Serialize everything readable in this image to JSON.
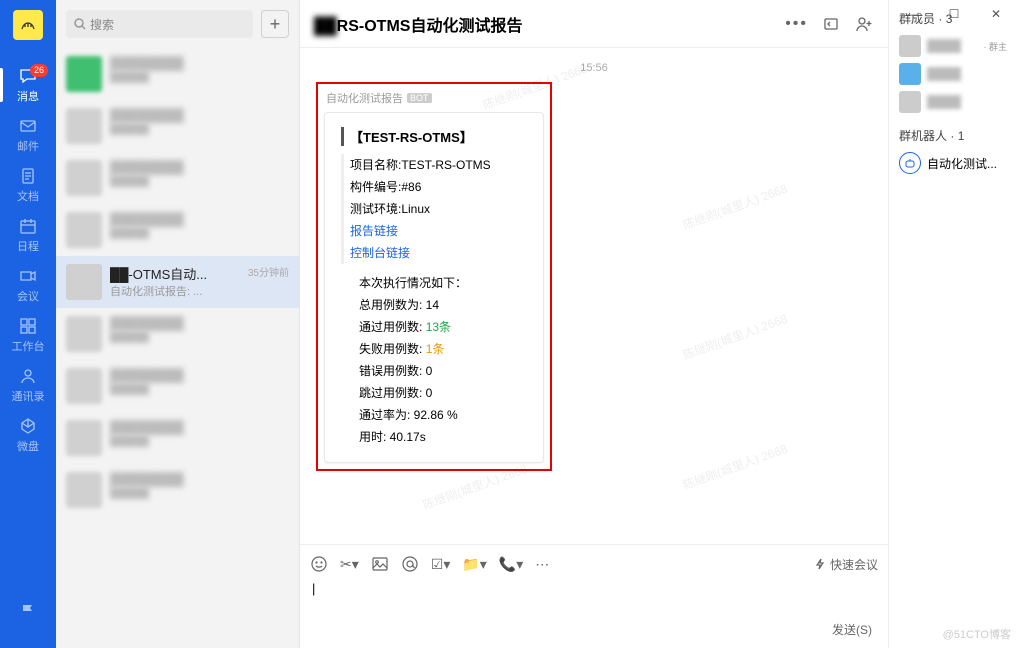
{
  "window": {
    "min": "—",
    "max": "☐",
    "close": "✕"
  },
  "nav": {
    "badge": "26",
    "items": [
      {
        "label": "消息",
        "icon": "chat",
        "active": true
      },
      {
        "label": "邮件",
        "icon": "mail"
      },
      {
        "label": "文档",
        "icon": "doc"
      },
      {
        "label": "日程",
        "icon": "calendar"
      },
      {
        "label": "会议",
        "icon": "meeting"
      },
      {
        "label": "工作台",
        "icon": "grid"
      },
      {
        "label": "通讯录",
        "icon": "contacts"
      },
      {
        "label": "微盘",
        "icon": "disk"
      }
    ]
  },
  "search": {
    "placeholder": "搜索"
  },
  "conversations": {
    "active_index": 4,
    "list": [
      {
        "title": "████",
        "sub": "█████",
        "avbg": "#3fbf6f"
      },
      {
        "title": "████",
        "sub": "█████",
        "avbg": "#d0d0d0"
      },
      {
        "title": "████",
        "sub": "█████",
        "avbg": "#d0d0d0"
      },
      {
        "title": "████",
        "sub": "█████",
        "avbg": "#d0d0d0"
      },
      {
        "title": "-OTMS自动...",
        "sub": "自动化测试报告: ...",
        "time": "35分钟前",
        "avbg": "#d0d0d0"
      },
      {
        "title": "████",
        "sub": "█████",
        "avbg": "#d0d0d0"
      },
      {
        "title": "████",
        "sub": "█████",
        "avbg": "#d0d0d0"
      },
      {
        "title": "████",
        "sub": "█████",
        "avbg": "#d0d0d0"
      },
      {
        "title": "████",
        "sub": "█████",
        "avbg": "#d0d0d0"
      }
    ]
  },
  "header": {
    "title_blur": "██",
    "title_rest": "RS-OTMS自动化测试报告"
  },
  "timestamp": "15:56",
  "message": {
    "sender": "自动化测试报告",
    "bot_tag": "BOT",
    "card_title": "【TEST-RS-OTMS】",
    "rows": {
      "project_label": "项目名称:",
      "project_value": "TEST-RS-OTMS",
      "build_label": "构件编号:",
      "build_value": "#86",
      "env_label": "测试环境:",
      "env_value": "Linux",
      "link1": "报告链接",
      "link2": "控制台链接"
    },
    "stats": {
      "heading": "本次执行情况如下：",
      "total": "总用例数为:  14",
      "pass_label": "通过用例数:",
      "pass_value": "13条",
      "fail_label": "失败用例数:",
      "fail_value": "1条",
      "error": "错误用例数:  0",
      "skip": "跳过用例数:  0",
      "rate": "通过率为:   92.86 %",
      "duration": "用时:  40.17s"
    }
  },
  "members": {
    "header_label": "群成员",
    "count": "3",
    "owner_tag": "· 群主",
    "bots_label": "群机器人",
    "bots_count": "1",
    "bot_name": "自动化测试..."
  },
  "input": {
    "quick_meeting": "快速会议",
    "send": "发送(S)"
  },
  "attribution": "@51CTO博客"
}
